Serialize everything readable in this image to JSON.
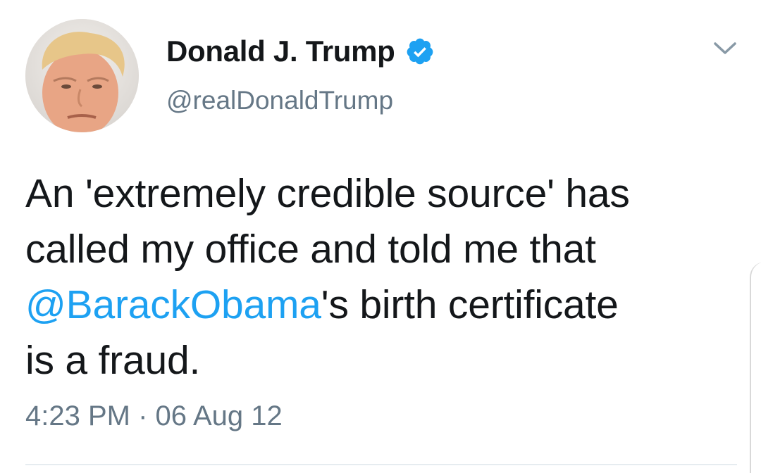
{
  "tweet": {
    "author": {
      "display_name": "Donald J. Trump",
      "handle": "@realDonaldTrump",
      "verified": true
    },
    "text": {
      "line1": "An 'extremely credible source' has",
      "line2": "called my office and told me that",
      "mention": "@BarackObama",
      "line3_rest": "'s birth certificate",
      "line4": "is a fraud."
    },
    "timestamp": {
      "time": "4:23 PM",
      "separator": "·",
      "date": "06 Aug 12"
    }
  },
  "colors": {
    "text": "#14171a",
    "secondary": "#657786",
    "link": "#1da1f2",
    "verified_badge": "#1da1f2"
  },
  "icons": {
    "verified": "verified-badge-icon",
    "menu": "chevron-down-icon"
  }
}
